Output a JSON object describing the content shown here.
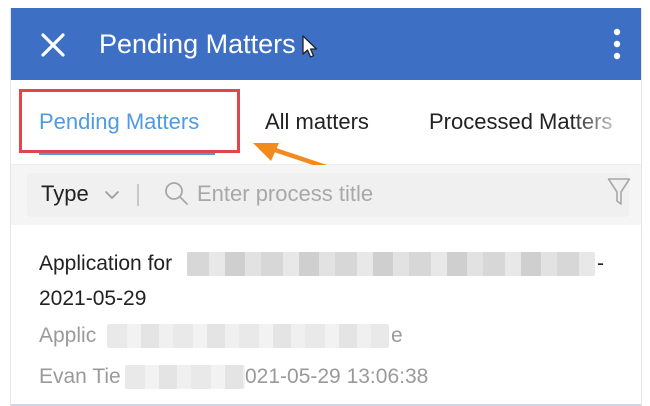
{
  "app_bar": {
    "title": "Pending Matters",
    "background_color": "#3d6fc4",
    "icons": [
      "close-icon",
      "cursor-icon",
      "more-vertical-icon"
    ]
  },
  "tabs": [
    {
      "label": "Pending Matters",
      "active": true
    },
    {
      "label": "All matters",
      "active": false
    },
    {
      "label": "Processed Matters",
      "active": false
    }
  ],
  "accent_color": "#4f9be0",
  "annotation": {
    "box_color": "#e0474a",
    "arrow_color": "#f28b1e"
  },
  "filter": {
    "type_label": "Type",
    "search_placeholder": "Enter process title",
    "icons": [
      "chevron-down-icon",
      "search-icon",
      "filter-icon"
    ]
  },
  "list": {
    "items": [
      {
        "title": "Application for",
        "title_suffix": "-",
        "date": "2021-05-29",
        "subtitle": "Applic",
        "subtitle_tail": "e",
        "submitter": "Evan Tie",
        "timestamp": "021-05-29 13:06:38"
      }
    ]
  }
}
